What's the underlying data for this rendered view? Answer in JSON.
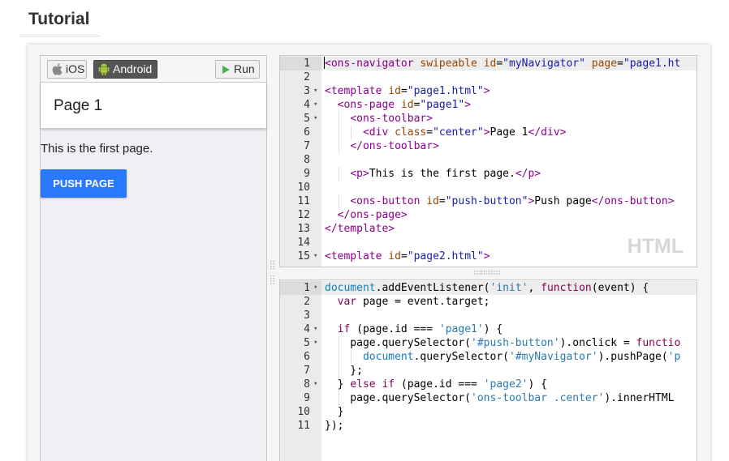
{
  "page": {
    "heading": "Tutorial"
  },
  "preview": {
    "tabs": [
      {
        "label": "iOS",
        "icon": "apple-icon"
      },
      {
        "label": "Android",
        "icon": "android-icon"
      }
    ],
    "run_label": "Run",
    "toolbar_title": "Page 1",
    "page_text": "This is the first page.",
    "push_button_label": "PUSH PAGE",
    "accent_color": "#2979ff"
  },
  "html_editor": {
    "mode_label": "HTML",
    "active_line": 1,
    "lines": [
      {
        "n": "1",
        "fold": false,
        "tokens": [
          [
            "t-tag",
            "<ons-navigator "
          ],
          [
            "t-attr",
            "swipeable "
          ],
          [
            "t-attr",
            "id"
          ],
          [
            "t-txt",
            "="
          ],
          [
            "t-str",
            "\"myNavigator\" "
          ],
          [
            "t-attr",
            "page"
          ],
          [
            "t-txt",
            "="
          ],
          [
            "t-str",
            "\"page1.ht"
          ]
        ]
      },
      {
        "n": "2",
        "fold": false,
        "tokens": []
      },
      {
        "n": "3",
        "fold": true,
        "tokens": [
          [
            "t-tag",
            "<template "
          ],
          [
            "t-attr",
            "id"
          ],
          [
            "t-txt",
            "="
          ],
          [
            "t-str",
            "\"page1.html\""
          ],
          [
            "t-tag",
            ">"
          ]
        ]
      },
      {
        "n": "4",
        "fold": true,
        "tokens": [
          [
            "t-txt",
            "  "
          ],
          [
            "t-tag",
            "<ons-page "
          ],
          [
            "t-attr",
            "id"
          ],
          [
            "t-txt",
            "="
          ],
          [
            "t-str",
            "\"page1\""
          ],
          [
            "t-tag",
            ">"
          ]
        ]
      },
      {
        "n": "5",
        "fold": true,
        "tokens": [
          [
            "t-txt",
            "    "
          ],
          [
            "t-tag",
            "<ons-toolbar>"
          ]
        ]
      },
      {
        "n": "6",
        "fold": false,
        "tokens": [
          [
            "t-txt",
            "      "
          ],
          [
            "t-tag",
            "<div "
          ],
          [
            "t-attr",
            "class"
          ],
          [
            "t-txt",
            "="
          ],
          [
            "t-str",
            "\"center\""
          ],
          [
            "t-tag",
            ">"
          ],
          [
            "t-txt",
            "Page 1"
          ],
          [
            "t-tag",
            "</div>"
          ]
        ]
      },
      {
        "n": "7",
        "fold": false,
        "tokens": [
          [
            "t-txt",
            "    "
          ],
          [
            "t-tag",
            "</ons-toolbar>"
          ]
        ]
      },
      {
        "n": "8",
        "fold": false,
        "tokens": []
      },
      {
        "n": "9",
        "fold": false,
        "tokens": [
          [
            "t-txt",
            "    "
          ],
          [
            "t-tag",
            "<p>"
          ],
          [
            "t-txt",
            "This is the first page."
          ],
          [
            "t-tag",
            "</p>"
          ]
        ]
      },
      {
        "n": "10",
        "fold": false,
        "tokens": []
      },
      {
        "n": "11",
        "fold": false,
        "tokens": [
          [
            "t-txt",
            "    "
          ],
          [
            "t-tag",
            "<ons-button "
          ],
          [
            "t-attr",
            "id"
          ],
          [
            "t-txt",
            "="
          ],
          [
            "t-str",
            "\"push-button\""
          ],
          [
            "t-tag",
            ">"
          ],
          [
            "t-txt",
            "Push page"
          ],
          [
            "t-tag",
            "</ons-button>"
          ]
        ]
      },
      {
        "n": "12",
        "fold": false,
        "tokens": [
          [
            "t-txt",
            "  "
          ],
          [
            "t-tag",
            "</ons-page>"
          ]
        ]
      },
      {
        "n": "13",
        "fold": false,
        "tokens": [
          [
            "t-tag",
            "</template>"
          ]
        ]
      },
      {
        "n": "14",
        "fold": false,
        "tokens": []
      },
      {
        "n": "15",
        "fold": true,
        "tokens": [
          [
            "t-tag",
            "<template "
          ],
          [
            "t-attr",
            "id"
          ],
          [
            "t-txt",
            "="
          ],
          [
            "t-str",
            "\"page2.html\""
          ],
          [
            "t-tag",
            ">"
          ]
        ]
      }
    ]
  },
  "js_editor": {
    "active_line": 1,
    "lines": [
      {
        "n": "1",
        "fold": true,
        "tokens": [
          [
            "t-kw2",
            "document"
          ],
          [
            "t-plain",
            ".addEventListener("
          ],
          [
            "t-strj",
            "'init'"
          ],
          [
            "t-plain",
            ", "
          ],
          [
            "t-kw",
            "function"
          ],
          [
            "t-plain",
            "(event) {"
          ]
        ]
      },
      {
        "n": "2",
        "fold": false,
        "tokens": [
          [
            "t-plain",
            "  "
          ],
          [
            "t-kw",
            "var"
          ],
          [
            "t-plain",
            " page = event.target;"
          ]
        ]
      },
      {
        "n": "3",
        "fold": false,
        "tokens": []
      },
      {
        "n": "4",
        "fold": true,
        "tokens": [
          [
            "t-plain",
            "  "
          ],
          [
            "t-kw",
            "if"
          ],
          [
            "t-plain",
            " (page.id === "
          ],
          [
            "t-strj",
            "'page1'"
          ],
          [
            "t-plain",
            ") {"
          ]
        ]
      },
      {
        "n": "5",
        "fold": true,
        "tokens": [
          [
            "t-plain",
            "    page.querySelector("
          ],
          [
            "t-strj",
            "'#push-button'"
          ],
          [
            "t-plain",
            ").onclick = "
          ],
          [
            "t-kw",
            "functio"
          ]
        ]
      },
      {
        "n": "6",
        "fold": false,
        "tokens": [
          [
            "t-plain",
            "      "
          ],
          [
            "t-kw2",
            "document"
          ],
          [
            "t-plain",
            ".querySelector("
          ],
          [
            "t-strj",
            "'#myNavigator'"
          ],
          [
            "t-plain",
            ").pushPage("
          ],
          [
            "t-strj",
            "'p"
          ]
        ]
      },
      {
        "n": "7",
        "fold": false,
        "tokens": [
          [
            "t-plain",
            "    };"
          ]
        ]
      },
      {
        "n": "8",
        "fold": true,
        "tokens": [
          [
            "t-plain",
            "  } "
          ],
          [
            "t-kw",
            "else if"
          ],
          [
            "t-plain",
            " (page.id === "
          ],
          [
            "t-strj",
            "'page2'"
          ],
          [
            "t-plain",
            ") {"
          ]
        ]
      },
      {
        "n": "9",
        "fold": false,
        "tokens": [
          [
            "t-plain",
            "    page.querySelector("
          ],
          [
            "t-strj",
            "'ons-toolbar .center'"
          ],
          [
            "t-plain",
            ").innerHTML"
          ]
        ]
      },
      {
        "n": "10",
        "fold": false,
        "tokens": [
          [
            "t-plain",
            "  }"
          ]
        ]
      },
      {
        "n": "11",
        "fold": false,
        "tokens": [
          [
            "t-plain",
            "});"
          ]
        ]
      }
    ]
  }
}
